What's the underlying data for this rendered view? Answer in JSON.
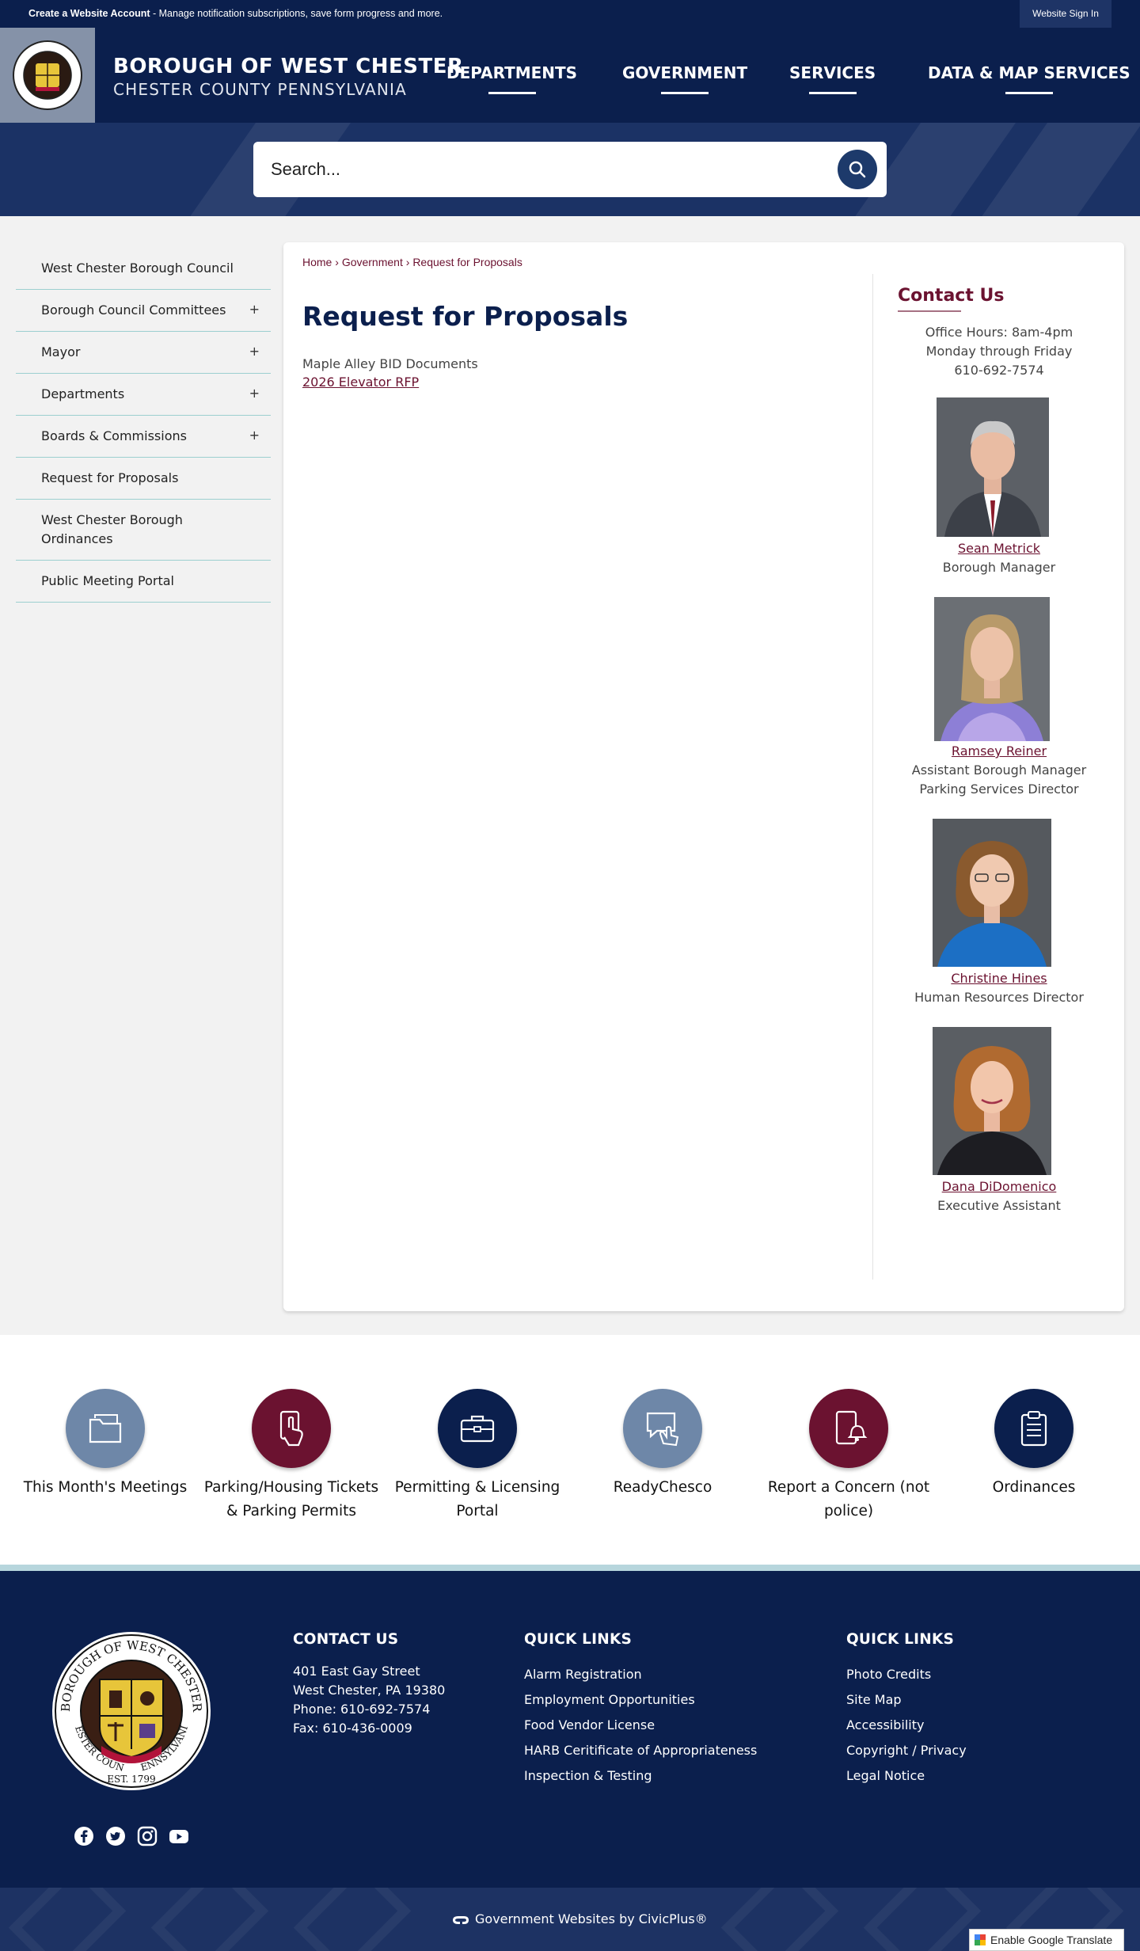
{
  "utility": {
    "account_link": "Create a Website Account",
    "account_desc": " - Manage notification subscriptions, save form progress and more.",
    "signin": "Website Sign In"
  },
  "header": {
    "title": "BOROUGH OF WEST CHESTER",
    "subtitle": "CHESTER COUNTY PENNSYLVANIA",
    "nav": [
      "DEPARTMENTS",
      "GOVERNMENT",
      "SERVICES",
      "DATA & MAP SERVICES"
    ]
  },
  "search": {
    "placeholder": "Search..."
  },
  "sidebar": {
    "items": [
      {
        "label": "West Chester Borough Council",
        "expand": ""
      },
      {
        "label": "Borough Council Committees",
        "expand": "+"
      },
      {
        "label": "Mayor",
        "expand": "+"
      },
      {
        "label": "Departments",
        "expand": "+"
      },
      {
        "label": "Boards & Commissions",
        "expand": "+"
      },
      {
        "label": "Request for Proposals",
        "expand": ""
      },
      {
        "label": "West Chester Borough Ordinances",
        "expand": ""
      },
      {
        "label": "Public Meeting Portal",
        "expand": ""
      }
    ]
  },
  "breadcrumb": [
    "Home",
    "Government",
    "Request for Proposals"
  ],
  "breadcrumb_sep": "›",
  "page": {
    "title": "Request for Proposals",
    "doc_text": "Maple Alley BID Documents",
    "doc_link": "2026 Elevator RFP"
  },
  "contact": {
    "title": "Contact Us",
    "hours": "Office Hours: 8am-4pm",
    "days": "Monday through Friday",
    "phone": "610-692-7574",
    "staff": [
      {
        "name": "Sean Metrick",
        "roles": [
          "Borough Manager"
        ]
      },
      {
        "name": "Ramsey Reiner",
        "roles": [
          "Assistant Borough Manager",
          "Parking Services Director"
        ]
      },
      {
        "name": "Christine Hines",
        "roles": [
          "Human Resources Director"
        ]
      },
      {
        "name": "Dana DiDomenico",
        "roles": [
          "Executive Assistant"
        ]
      }
    ]
  },
  "tiles": [
    {
      "label": "This Month's Meetings",
      "icon": "folder-icon",
      "color": "#6e87a8"
    },
    {
      "label": "Parking/Housing Tickets & Parking Permits",
      "icon": "phone-tap-icon",
      "color": "#6b1230"
    },
    {
      "label": "Permitting & Licensing Portal",
      "icon": "briefcase-icon",
      "color": "#0b1f4d"
    },
    {
      "label": "ReadyChesco",
      "icon": "chat-tap-icon",
      "color": "#6e87a8"
    },
    {
      "label": "Report a Concern (not police)",
      "icon": "phone-bell-icon",
      "color": "#6b1230"
    },
    {
      "label": "Ordinances",
      "icon": "clipboard-icon",
      "color": "#0b1f4d"
    }
  ],
  "footer": {
    "contact_title": "CONTACT US",
    "address1": "401 East Gay Street",
    "address2": "West Chester, PA 19380",
    "phone": "Phone: 610-692-7574",
    "fax": "Fax: 610-436-0009",
    "ql1_title": "QUICK LINKS",
    "ql1": [
      "Alarm Registration",
      "Employment Opportunities",
      "Food Vendor License",
      "HARB Ceritificate of Appropriateness",
      "Inspection & Testing"
    ],
    "ql2_title": "QUICK LINKS",
    "ql2": [
      "Photo Credits",
      "Site Map",
      "Accessibility",
      "Copyright / Privacy",
      "Legal Notice"
    ],
    "social": [
      "facebook-icon",
      "twitter-icon",
      "instagram-icon",
      "youtube-icon"
    ],
    "seal_top": "BOROUGH OF WEST CHESTER",
    "seal_left": "CHESTER COUNTY",
    "seal_right": "PENNSYLVANIA",
    "seal_est": "EST. 1799"
  },
  "bottom": {
    "civic": "Government Websites by CivicPlus®",
    "translate": "Enable Google Translate"
  },
  "colors": {
    "navy": "#0b1f4d",
    "maroon": "#6b1230",
    "slate": "#6e87a8",
    "teal_rule": "#9ccfd0"
  }
}
